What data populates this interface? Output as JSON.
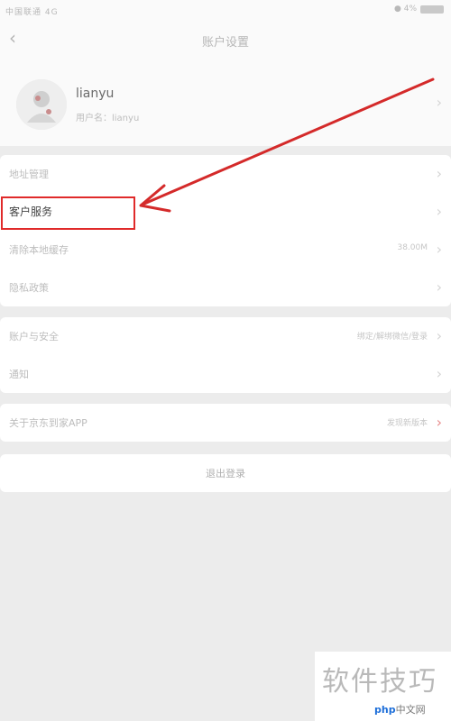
{
  "status_bar": {
    "left": "中国联通 4G",
    "right": "● 4%"
  },
  "nav": {
    "title": "账户设置"
  },
  "profile": {
    "name": "lianyu",
    "id": "用户名：lianyu"
  },
  "group1": [
    {
      "label": "地址管理",
      "value": ""
    },
    {
      "label": "客户服务",
      "value": ""
    },
    {
      "label": "清除本地缓存",
      "value": "38.00M"
    },
    {
      "label": "隐私政策",
      "value": ""
    }
  ],
  "group2": [
    {
      "label": "账户与安全",
      "value": "绑定/解绑微信/登录"
    },
    {
      "label": "通知",
      "value": ""
    }
  ],
  "about": {
    "label": "关于京东到家APP",
    "value": "发现新版本"
  },
  "logout": {
    "label": "退出登录"
  },
  "watermark": {
    "text": "软件技巧",
    "php_brand": "php",
    "php_suffix": "中文网"
  },
  "colors": {
    "highlight": "#e02a2a",
    "background": "#ececec"
  }
}
